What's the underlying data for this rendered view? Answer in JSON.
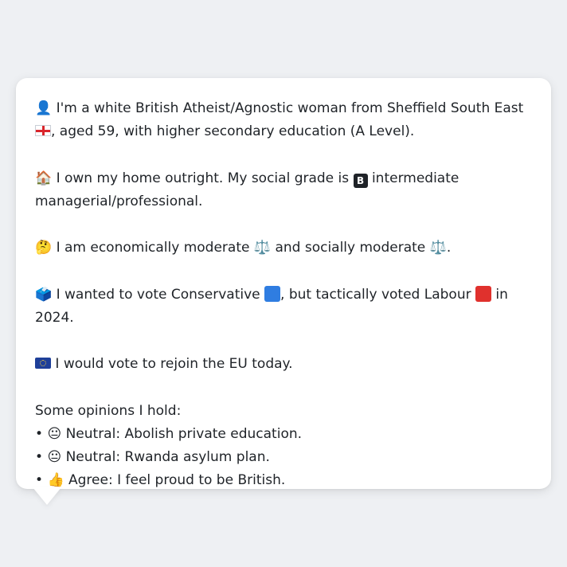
{
  "profile": {
    "identity": {
      "icon": "person-silhouette-icon",
      "text_before_flag": "I'm a white British Atheist/Agnostic woman from Sheffield South East",
      "flag": "england-flag-icon",
      "text_after_flag": ", aged 59, with higher secondary education (A Level)."
    },
    "home": {
      "icon": "house-icon",
      "text_before_badge": "I own my home outright. My social grade is",
      "badge": "B",
      "text_after_badge": "intermediate managerial/professional."
    },
    "politics": {
      "icon": "thinking-face-icon",
      "economic": "I am economically moderate",
      "connector": "and socially moderate",
      "end": ".",
      "scale_icon": "balance-scale-icon"
    },
    "vote": {
      "icon": "ballot-box-icon",
      "part1": "I wanted to vote Conservative",
      "part2": ", but tactically voted Labour",
      "part3": "in 2024.",
      "conservative_color": "#2f7de1",
      "labour_color": "#e0312d"
    },
    "eu": {
      "icon": "eu-flag-icon",
      "text": "I would vote to rejoin the EU today."
    },
    "opinions": {
      "heading": "Some opinions I hold:",
      "items": [
        {
          "bullet": "•",
          "icon": "neutral-face-icon",
          "text": "Neutral: Abolish private education."
        },
        {
          "bullet": "•",
          "icon": "neutral-face-icon",
          "text": "Neutral: Rwanda asylum plan."
        },
        {
          "bullet": "•",
          "icon": "thumbs-up-icon",
          "text": "Agree: I feel proud to be British."
        }
      ]
    }
  },
  "glyphs": {
    "person": "👤",
    "house": "🏠",
    "thinking": "🤔",
    "scale": "⚖️",
    "ballot": "🗳️",
    "neutral": "😐",
    "thumbs": "👍"
  }
}
